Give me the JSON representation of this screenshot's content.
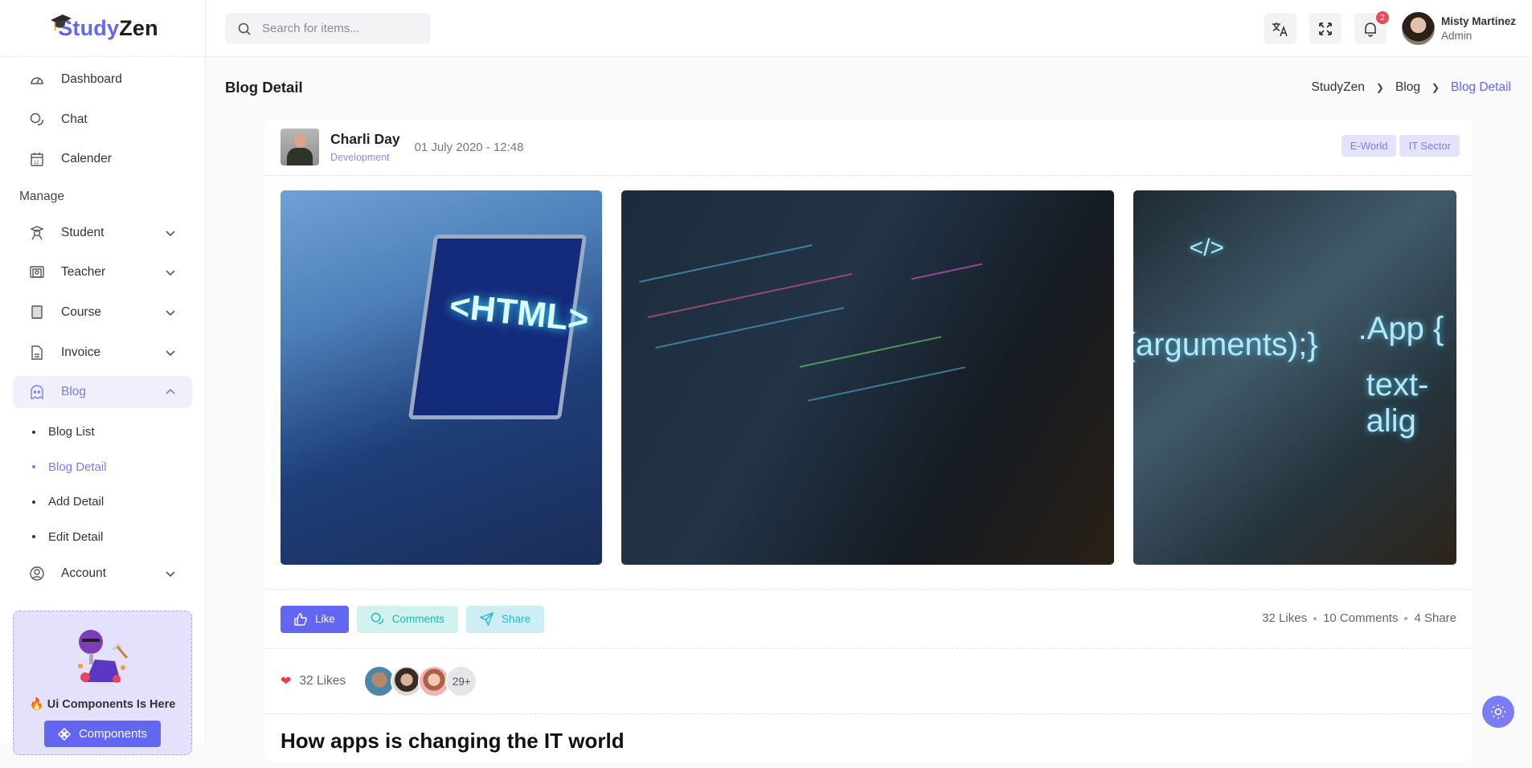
{
  "brand": {
    "part1": "Study",
    "part2": "Zen"
  },
  "sidebar": {
    "items": [
      {
        "label": "Dashboard",
        "icon": "gauge-icon"
      },
      {
        "label": "Chat",
        "icon": "chat-icon"
      },
      {
        "label": "Calender",
        "icon": "calendar-icon"
      }
    ],
    "section_label": "Manage",
    "manage_items": [
      {
        "label": "Student",
        "icon": "student-icon"
      },
      {
        "label": "Teacher",
        "icon": "teacher-icon"
      },
      {
        "label": "Course",
        "icon": "book-icon"
      },
      {
        "label": "Invoice",
        "icon": "invoice-icon"
      },
      {
        "label": "Blog",
        "icon": "ghost-icon",
        "active": true
      }
    ],
    "blog_sub": [
      "Blog List",
      "Blog Detail",
      "Add Detail",
      "Edit Detail"
    ],
    "blog_sub_active": "Blog Detail",
    "account": {
      "label": "Account",
      "icon": "user-circle-icon"
    },
    "promo": {
      "title": "🔥 Ui Components Is Here",
      "button": "Components"
    }
  },
  "topbar": {
    "search_placeholder": "Search for items...",
    "notification_count": "2",
    "user": {
      "name": "Misty Martinez",
      "role": "Admin"
    }
  },
  "page": {
    "title": "Blog Detail",
    "breadcrumb": [
      "StudyZen",
      "Blog",
      "Blog Detail"
    ]
  },
  "post": {
    "author": "Charli Day",
    "category": "Development",
    "date": "01 July 2020 - 12:48",
    "tags": [
      "E-World",
      "IT Sector"
    ],
    "images": [
      {
        "alt": "Laptop showing glowing <HTML> text"
      },
      {
        "alt": "Developer typing with code overlay"
      },
      {
        "alt": "Person with holographic code (arguments);} .App { text-align"
      }
    ],
    "image_text": {
      "img1": "<HTML>",
      "img3a": "(arguments);}",
      "img3b": ".App {",
      "img3c": "text-alig"
    },
    "actions": {
      "like": "Like",
      "comments": "Comments",
      "share": "Share"
    },
    "stats": {
      "likes": "32 Likes",
      "comments": "10 Comments",
      "shares": "4 Share"
    },
    "likes_label": "32 Likes",
    "more_likers": "29+",
    "title": "How apps is changing the IT world"
  },
  "colors": {
    "accent": "#6366f1",
    "badge": "#f0475b",
    "comment": "#22b5ab",
    "share": "#21b7d1"
  }
}
